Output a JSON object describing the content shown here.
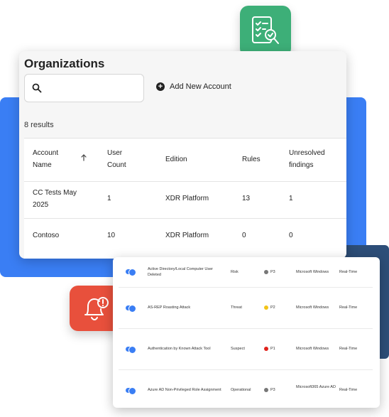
{
  "org": {
    "title": "Organizations",
    "search_placeholder": "",
    "add_button_label": "Add New Account",
    "results_text": "8 results",
    "columns": {
      "account_name": "Account Name",
      "user_count": "User Count",
      "edition": "Edition",
      "rules": "Rules",
      "unresolved": "Unresolved findings"
    },
    "rows": [
      {
        "name": "CC Tests May 2025",
        "users": "1",
        "edition": "XDR Platform",
        "rules": "13",
        "unresolved": "1"
      },
      {
        "name": "Contoso",
        "users": "10",
        "edition": "XDR Platform",
        "rules": "0",
        "unresolved": "0"
      }
    ]
  },
  "rules": [
    {
      "name": "Active Directory/Local Computer User Deleted",
      "type": "Risk",
      "priority": "P3",
      "priority_color": "#777777",
      "platform": "Microsoft Windows",
      "mode": "Real-Time"
    },
    {
      "name": "AS-REP Roasting Attack",
      "type": "Threat",
      "priority": "P2",
      "priority_color": "#f2c418",
      "platform": "Microsoft Windows",
      "mode": "Real-Time"
    },
    {
      "name": "Authentication by Known Attack Tool",
      "type": "Suspect",
      "priority": "P1",
      "priority_color": "#e0221c",
      "platform": "Microsoft Windows",
      "mode": "Real-Time"
    },
    {
      "name": "Azure AD Non-Privileged Role Assignment",
      "type": "Operational",
      "priority": "P3",
      "priority_color": "#777777",
      "platform": "Microsoft365 Azure AD",
      "mode": "Real-Time"
    }
  ],
  "colors": {
    "accent": "#3a7ef4",
    "navy": "#2d4e78",
    "green_tile": "#3daf78",
    "red_tile": "#e8503c"
  },
  "icons": {
    "green_tile": "checklist-search-icon",
    "red_tile": "bell-alert-icon"
  }
}
